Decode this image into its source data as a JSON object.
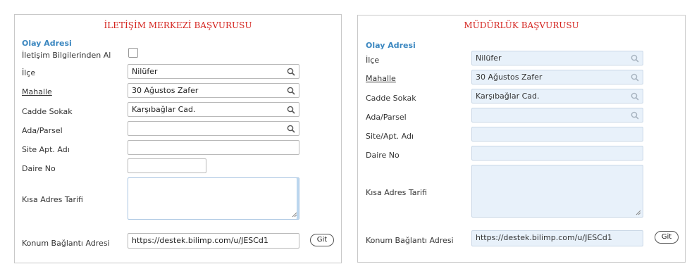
{
  "left_panel": {
    "title": "İLETİŞİM MERKEZİ BAŞVURUSU",
    "section_title": "Olay Adresi",
    "contact_info_label": "İletişim Bilgilerinden Al",
    "district_label": "İlçe",
    "district_value": "Nilüfer",
    "neighborhood_label": "Mahalle",
    "neighborhood_value": "30 Ağustos Zafer",
    "street_label": "Cadde Sokak",
    "street_value": "Karşıbağlar Cad.",
    "parcel_label": "Ada/Parsel",
    "parcel_value": "",
    "site_label": "Site Apt. Adı",
    "site_value": "",
    "door_label": "Daire No",
    "door_value": "",
    "short_desc_label": "Kısa Adres Tarifi",
    "location_label": "Konum Bağlantı Adresi",
    "location_value": "https://destek.bilimp.com/u/JESCd1",
    "go_button": "Git"
  },
  "right_panel": {
    "title": "MÜDÜRLÜK BAŞVURUSU",
    "section_title": "Olay Adresi",
    "district_label": "İlçe",
    "district_value": "Nilüfer",
    "neighborhood_label": "Mahalle",
    "neighborhood_value": "30 Ağustos Zafer",
    "street_label": "Cadde Sokak",
    "street_value": "Karşıbağlar Cad.",
    "parcel_label": "Ada/Parsel",
    "parcel_value": "",
    "site_label": "Site/Apt. Adı",
    "site_value": "",
    "door_label": "Daire No",
    "door_value": "",
    "short_desc_label": "Kısa Adres Tarifi",
    "location_label": "Konum Bağlantı Adresi",
    "location_value": "https://destek.bilimp.com/u/JESCd1",
    "go_button": "Git"
  },
  "colors": {
    "title_red": "#d4231e",
    "section_blue": "#3b87c0",
    "readonly_bg": "#e8f1fa"
  }
}
